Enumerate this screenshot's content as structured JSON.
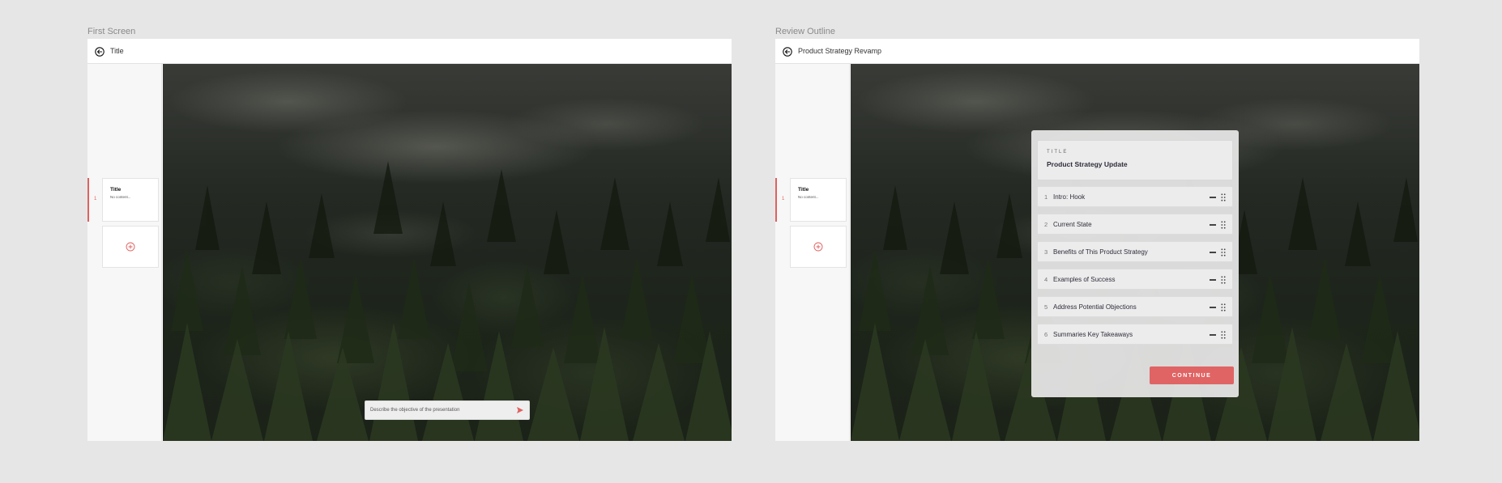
{
  "colors": {
    "accent": "#e06060",
    "background": "#e6e6e6"
  },
  "screens": [
    {
      "label": "First Screen",
      "topbar": {
        "back_icon": "arrow-left-circle-icon",
        "title": "Title"
      },
      "sidebar": {
        "slides": [
          {
            "number": "1",
            "title": "Title",
            "subtitle": "No content..."
          }
        ],
        "add_icon": "plus-circle-icon"
      },
      "prompt": {
        "placeholder": "Describe the objective of the presentation",
        "send_icon": "send-icon"
      }
    },
    {
      "label": "Review Outline",
      "topbar": {
        "back_icon": "arrow-left-circle-icon",
        "title": "Product Strategy Revamp"
      },
      "sidebar": {
        "slides": [
          {
            "number": "1",
            "title": "Title",
            "subtitle": "No content..."
          }
        ],
        "add_icon": "plus-circle-icon"
      },
      "outline": {
        "title_label": "TITLE",
        "title_value": "Product Strategy Update",
        "items": [
          {
            "number": "1",
            "label": "Intro: Hook"
          },
          {
            "number": "2",
            "label": "Current State"
          },
          {
            "number": "3",
            "label": "Benefits of This Product Strategy"
          },
          {
            "number": "4",
            "label": "Examples of Success"
          },
          {
            "number": "5",
            "label": "Address Potential Objections"
          },
          {
            "number": "6",
            "label": "Summaries Key Takeaways"
          }
        ],
        "continue_label": "CONTINUE"
      }
    }
  ]
}
